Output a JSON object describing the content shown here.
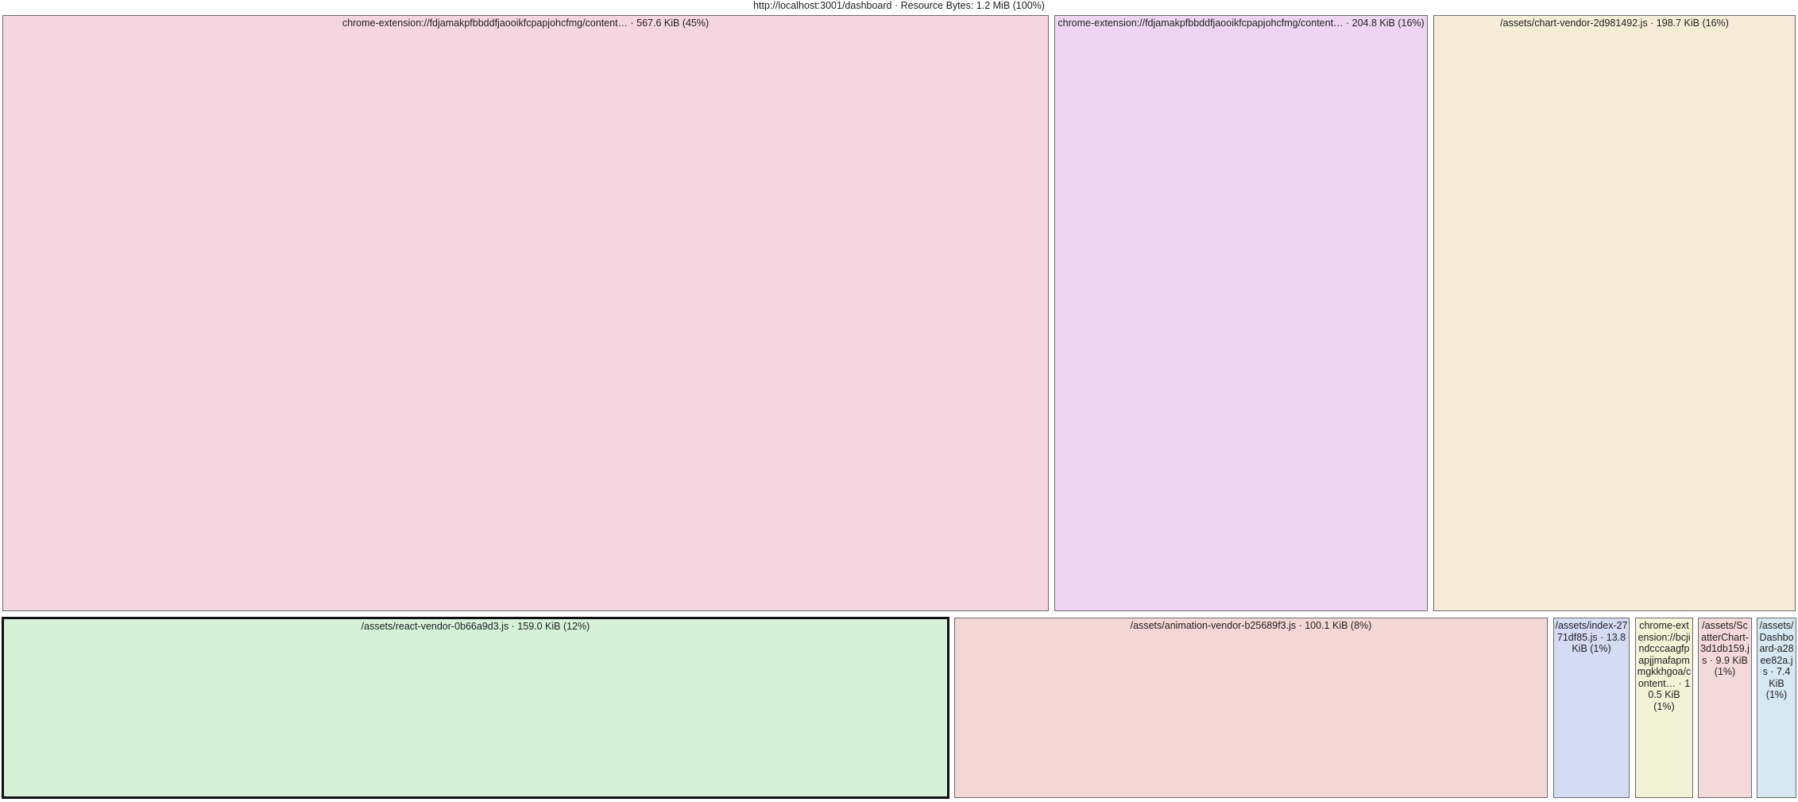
{
  "header": {
    "title": "http://localhost:3001/dashboard · Resource Bytes: 1.2 MiB (100%)"
  },
  "nodes": [
    {
      "label": "chrome-extension://fdjamakpfbbddfjaooikfcpapjohcfmg/content… · 567.6 KiB (45%)",
      "color": "#f5d6e0"
    },
    {
      "label": "chrome-extension://fdjamakpfbbddfjaooikfcpapjohcfmg/content… · 204.8 KiB (16%)",
      "color": "#eed6f2"
    },
    {
      "label": "/assets/chart-vendor-2d981492.js · 198.7 KiB (16%)",
      "color": "#f4ecd6"
    },
    {
      "label": "/assets/react-vendor-0b66a9d3.js · 159.0 KiB (12%)",
      "color": "#d5f2d9",
      "selected": true
    },
    {
      "label": "/assets/animation-vendor-b25689f3.js · 100.1 KiB (8%)",
      "color": "#f3d7d6"
    },
    {
      "label": "/assets/index-2771df85.js · 13.8 KiB (1%)",
      "color": "#d6dbf4"
    },
    {
      "label": "chrome-extension://bcjindcccaagfpapjjmafapmmgkkhgoa/content… · 10.5 KiB (1%)",
      "color": "#f1f2d6"
    },
    {
      "label": "/assets/ScatterChart-3d1db159.js · 9.9 KiB (1%)",
      "color": "#f3d9d9"
    },
    {
      "label": "/assets/Dashboard-a28ee82a.js · 7.4 KiB (1%)",
      "color": "#d6e9f2"
    }
  ]
}
